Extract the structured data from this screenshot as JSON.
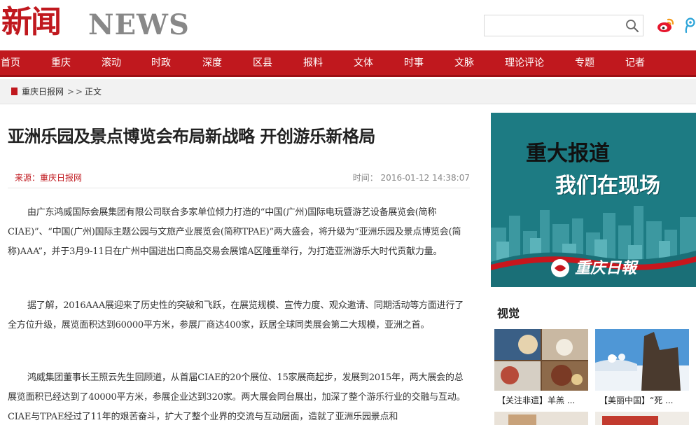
{
  "header": {
    "logo_cn": "新闻",
    "logo_en": "NEWS",
    "search": {
      "value": "",
      "placeholder": ""
    }
  },
  "nav": {
    "items": [
      "首页",
      "重庆",
      "滚动",
      "时政",
      "深度",
      "区县",
      "报料",
      "文体",
      "时事",
      "文脉",
      "理论评论",
      "专题",
      "记者"
    ],
    "color": "#c0181e"
  },
  "breadcrumb": {
    "home": "重庆日报网",
    "sep1": ">",
    "sep2": ">",
    "current": "正文"
  },
  "article": {
    "title": "亚洲乐园及景点博览会布局新战略 开创游乐新格局",
    "source": "来源：重庆日报网",
    "time": "时间： 2016-01-12 14:38:07",
    "paragraphs": [
      "由广东鸿威国际会展集团有限公司联合多家单位倾力打造的“中国(广州)国际电玩暨游艺设备展览会(简称CIAE)”、“中国(广州)国际主题公园与文旅产业展览会(简称TPAE)”两大盛会，将升级为“亚洲乐园及景点博览会(简称)AAA”，并于3月9-11日在广州中国进出口商品交易会展馆A区隆重举行，为打造亚洲游乐大时代贡献力量。",
      "据了解，2016AAA展迎来了历史性的突破和飞跃，在展览规模、宣传力度、观众邀请、同期活动等方面进行了全方位升级，展览面积达到60000平方米，参展厂商达400家，跃居全球同类展会第二大规模，亚洲之首。",
      "鸿威集团董事长王照云先生回顾道，从首届CIAE的20个展位、15家展商起步，发展到2015年，两大展会的总展览面积已经达到了40000平方米，参展企业达到320家。两大展会同台展出，加深了整个游乐行业的交融与互动。CIAE与TPAE经过了11年的艰苦奋斗，扩大了整个业界的交流与互动层面，造就了亚洲乐园景点和"
    ]
  },
  "sidebar": {
    "banner": {
      "line1": "重大报道",
      "line2": "我们在现场",
      "logo_text": "重庆日報",
      "bg_color": "#1d7b83"
    },
    "section_title": "视觉",
    "thumbs": [
      {
        "caption": "【关注非遗】羊羔 ..."
      },
      {
        "caption": "【美丽中国】“死 ..."
      }
    ]
  }
}
